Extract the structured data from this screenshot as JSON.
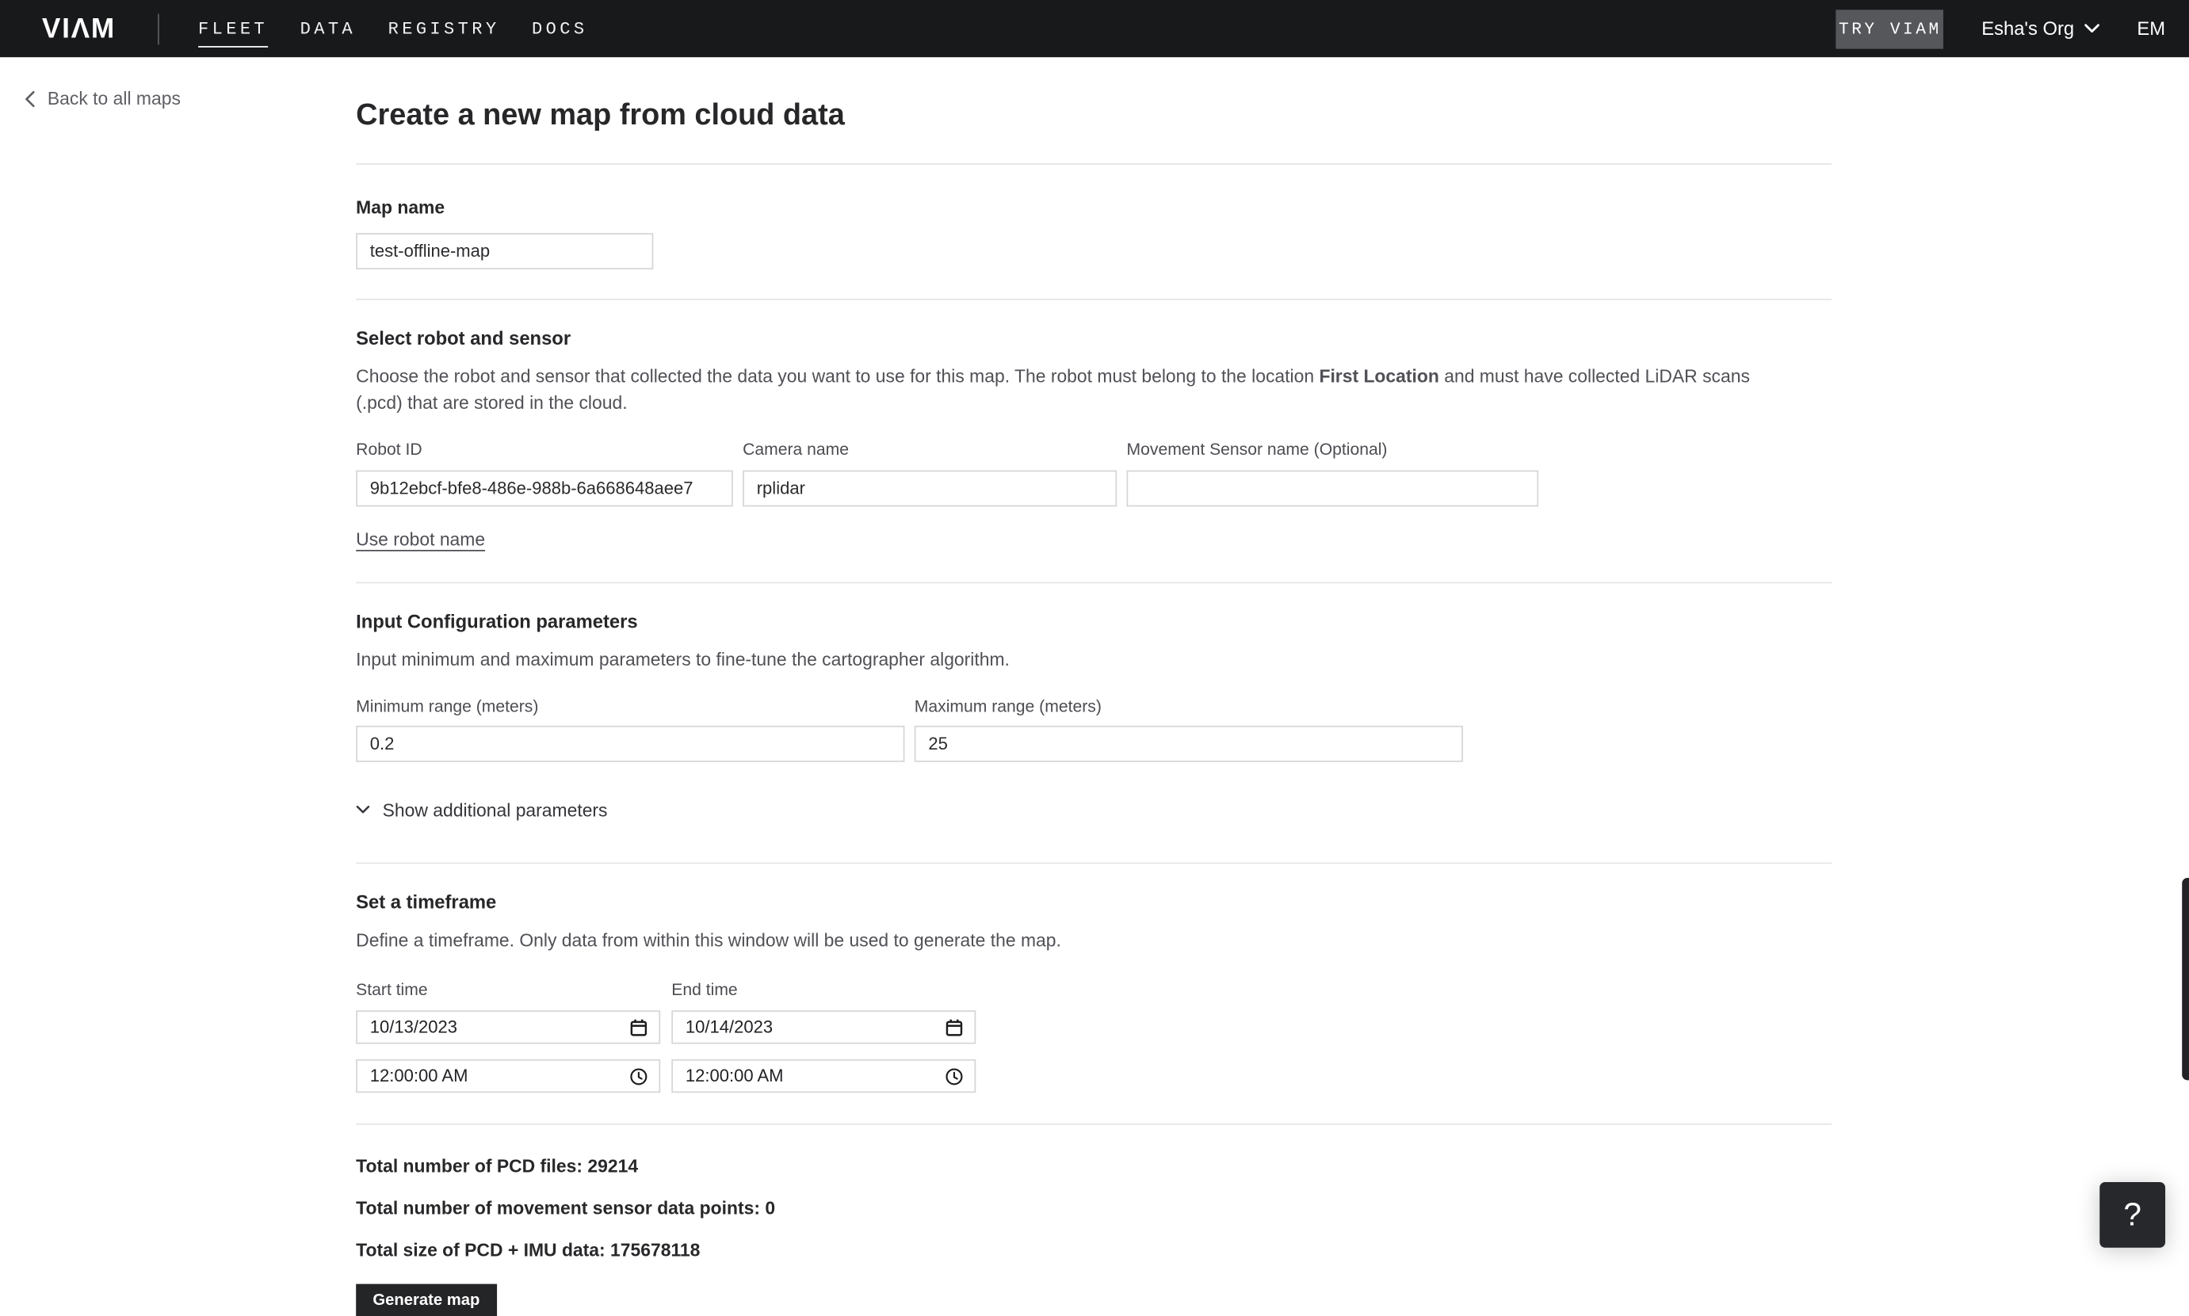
{
  "nav": {
    "logo": "VIΛM",
    "items": [
      {
        "label": "FLEET",
        "active": true
      },
      {
        "label": "DATA",
        "active": false
      },
      {
        "label": "REGISTRY",
        "active": false
      },
      {
        "label": "DOCS",
        "active": false
      }
    ],
    "try_viam_label": "TRY VIAM",
    "org_name": "Esha's Org",
    "user_initials": "EM"
  },
  "back_link_label": "Back to all maps",
  "page_title": "Create a new map from cloud data",
  "map_name": {
    "label": "Map name",
    "value": "test-offline-map"
  },
  "robot_section": {
    "heading": "Select robot and sensor",
    "description_before": "Choose the robot and sensor that collected the data you want to use for this map. The robot must belong to the location ",
    "description_bold": "First Location",
    "description_after": " and must have collected LiDAR scans (.pcd) that are stored in the cloud.",
    "robot_id": {
      "label": "Robot ID",
      "value": "9b12ebcf-bfe8-486e-988b-6a668648aee7"
    },
    "camera_name": {
      "label": "Camera name",
      "value": "rplidar"
    },
    "movement_sensor": {
      "label": "Movement Sensor name (Optional)",
      "value": ""
    },
    "use_robot_name_label": "Use robot name"
  },
  "config_section": {
    "heading": "Input Configuration parameters",
    "description": "Input minimum and maximum parameters to fine-tune the cartographer algorithm.",
    "min_range": {
      "label": "Minimum range (meters)",
      "value": "0.2"
    },
    "max_range": {
      "label": "Maximum range (meters)",
      "value": "25"
    },
    "show_additional_label": "Show additional parameters"
  },
  "timeframe_section": {
    "heading": "Set a timeframe",
    "description": "Define a timeframe. Only data from within this window will be used to generate the map.",
    "start": {
      "label": "Start time",
      "date": "10/13/2023",
      "time": "12:00:00 AM"
    },
    "end": {
      "label": "End time",
      "date": "10/14/2023",
      "time": "12:00:00 AM"
    }
  },
  "summary": {
    "pcd_files_label": "Total number of PCD files:",
    "pcd_files_value": "29214",
    "movement_points_label": "Total number of movement sensor data points:",
    "movement_points_value": "0",
    "total_size_label": "Total size of PCD + IMU data:",
    "total_size_value": "175678118"
  },
  "generate_button_label": "Generate map",
  "help_button_label": "?",
  "colors": {
    "nav_background": "#18191b",
    "try_viam_background": "#55575b",
    "primary_button_background": "#242527",
    "divider": "#e5e5e8",
    "input_border": "#d6d6d8"
  }
}
